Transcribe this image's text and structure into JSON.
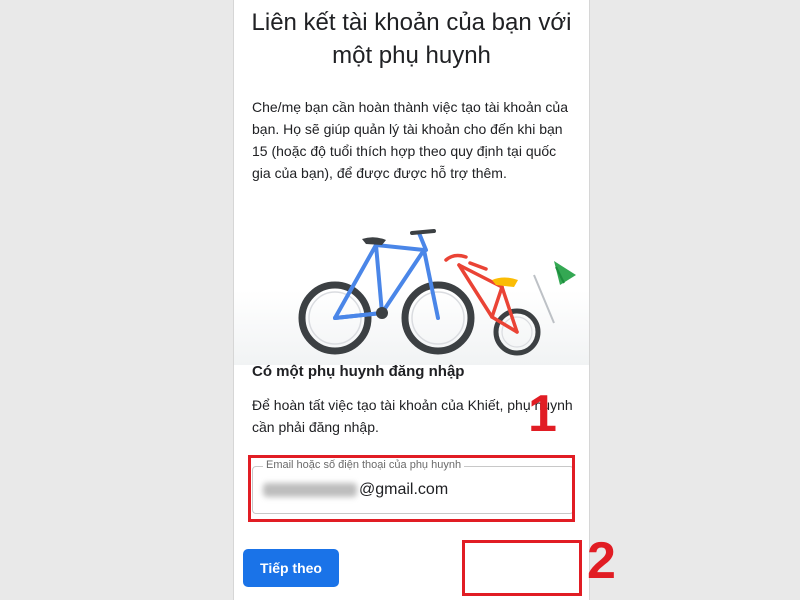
{
  "screen": {
    "title_line1": "Liên kết tài khoản của bạn với",
    "title_line2": "một phụ huynh",
    "description": "Che/mẹ bạn cần hoàn thành việc tạo tài khoản của bạn. Họ sẽ giúp quản lý tài khoản cho đến khi bạn 15 (hoặc độ tuổi thích hợp theo quy định tại quốc gia của bạn), để được được hỗ trợ thêm.",
    "subheading": "Có một phụ huynh đăng nhập",
    "subtext": "Để hoàn tất việc tạo tài khoản của Khiết, phụ huynh cần phải đăng nhập.",
    "email_field": {
      "label": "Email hoặc số điện thoại của phụ huynh",
      "value_suffix": "@gmail.com",
      "value_prefix_icon": "blurred-text"
    },
    "next_button": "Tiếp theo"
  },
  "annotations": {
    "step1": "1",
    "step2": "2",
    "highlight_color": "#e11d24"
  },
  "colors": {
    "primary_button": "#1a73e8",
    "big_bike": "#4a86e8",
    "small_bike": "#ea4335",
    "seat": "#fbbc04",
    "flag": "#34a853"
  }
}
